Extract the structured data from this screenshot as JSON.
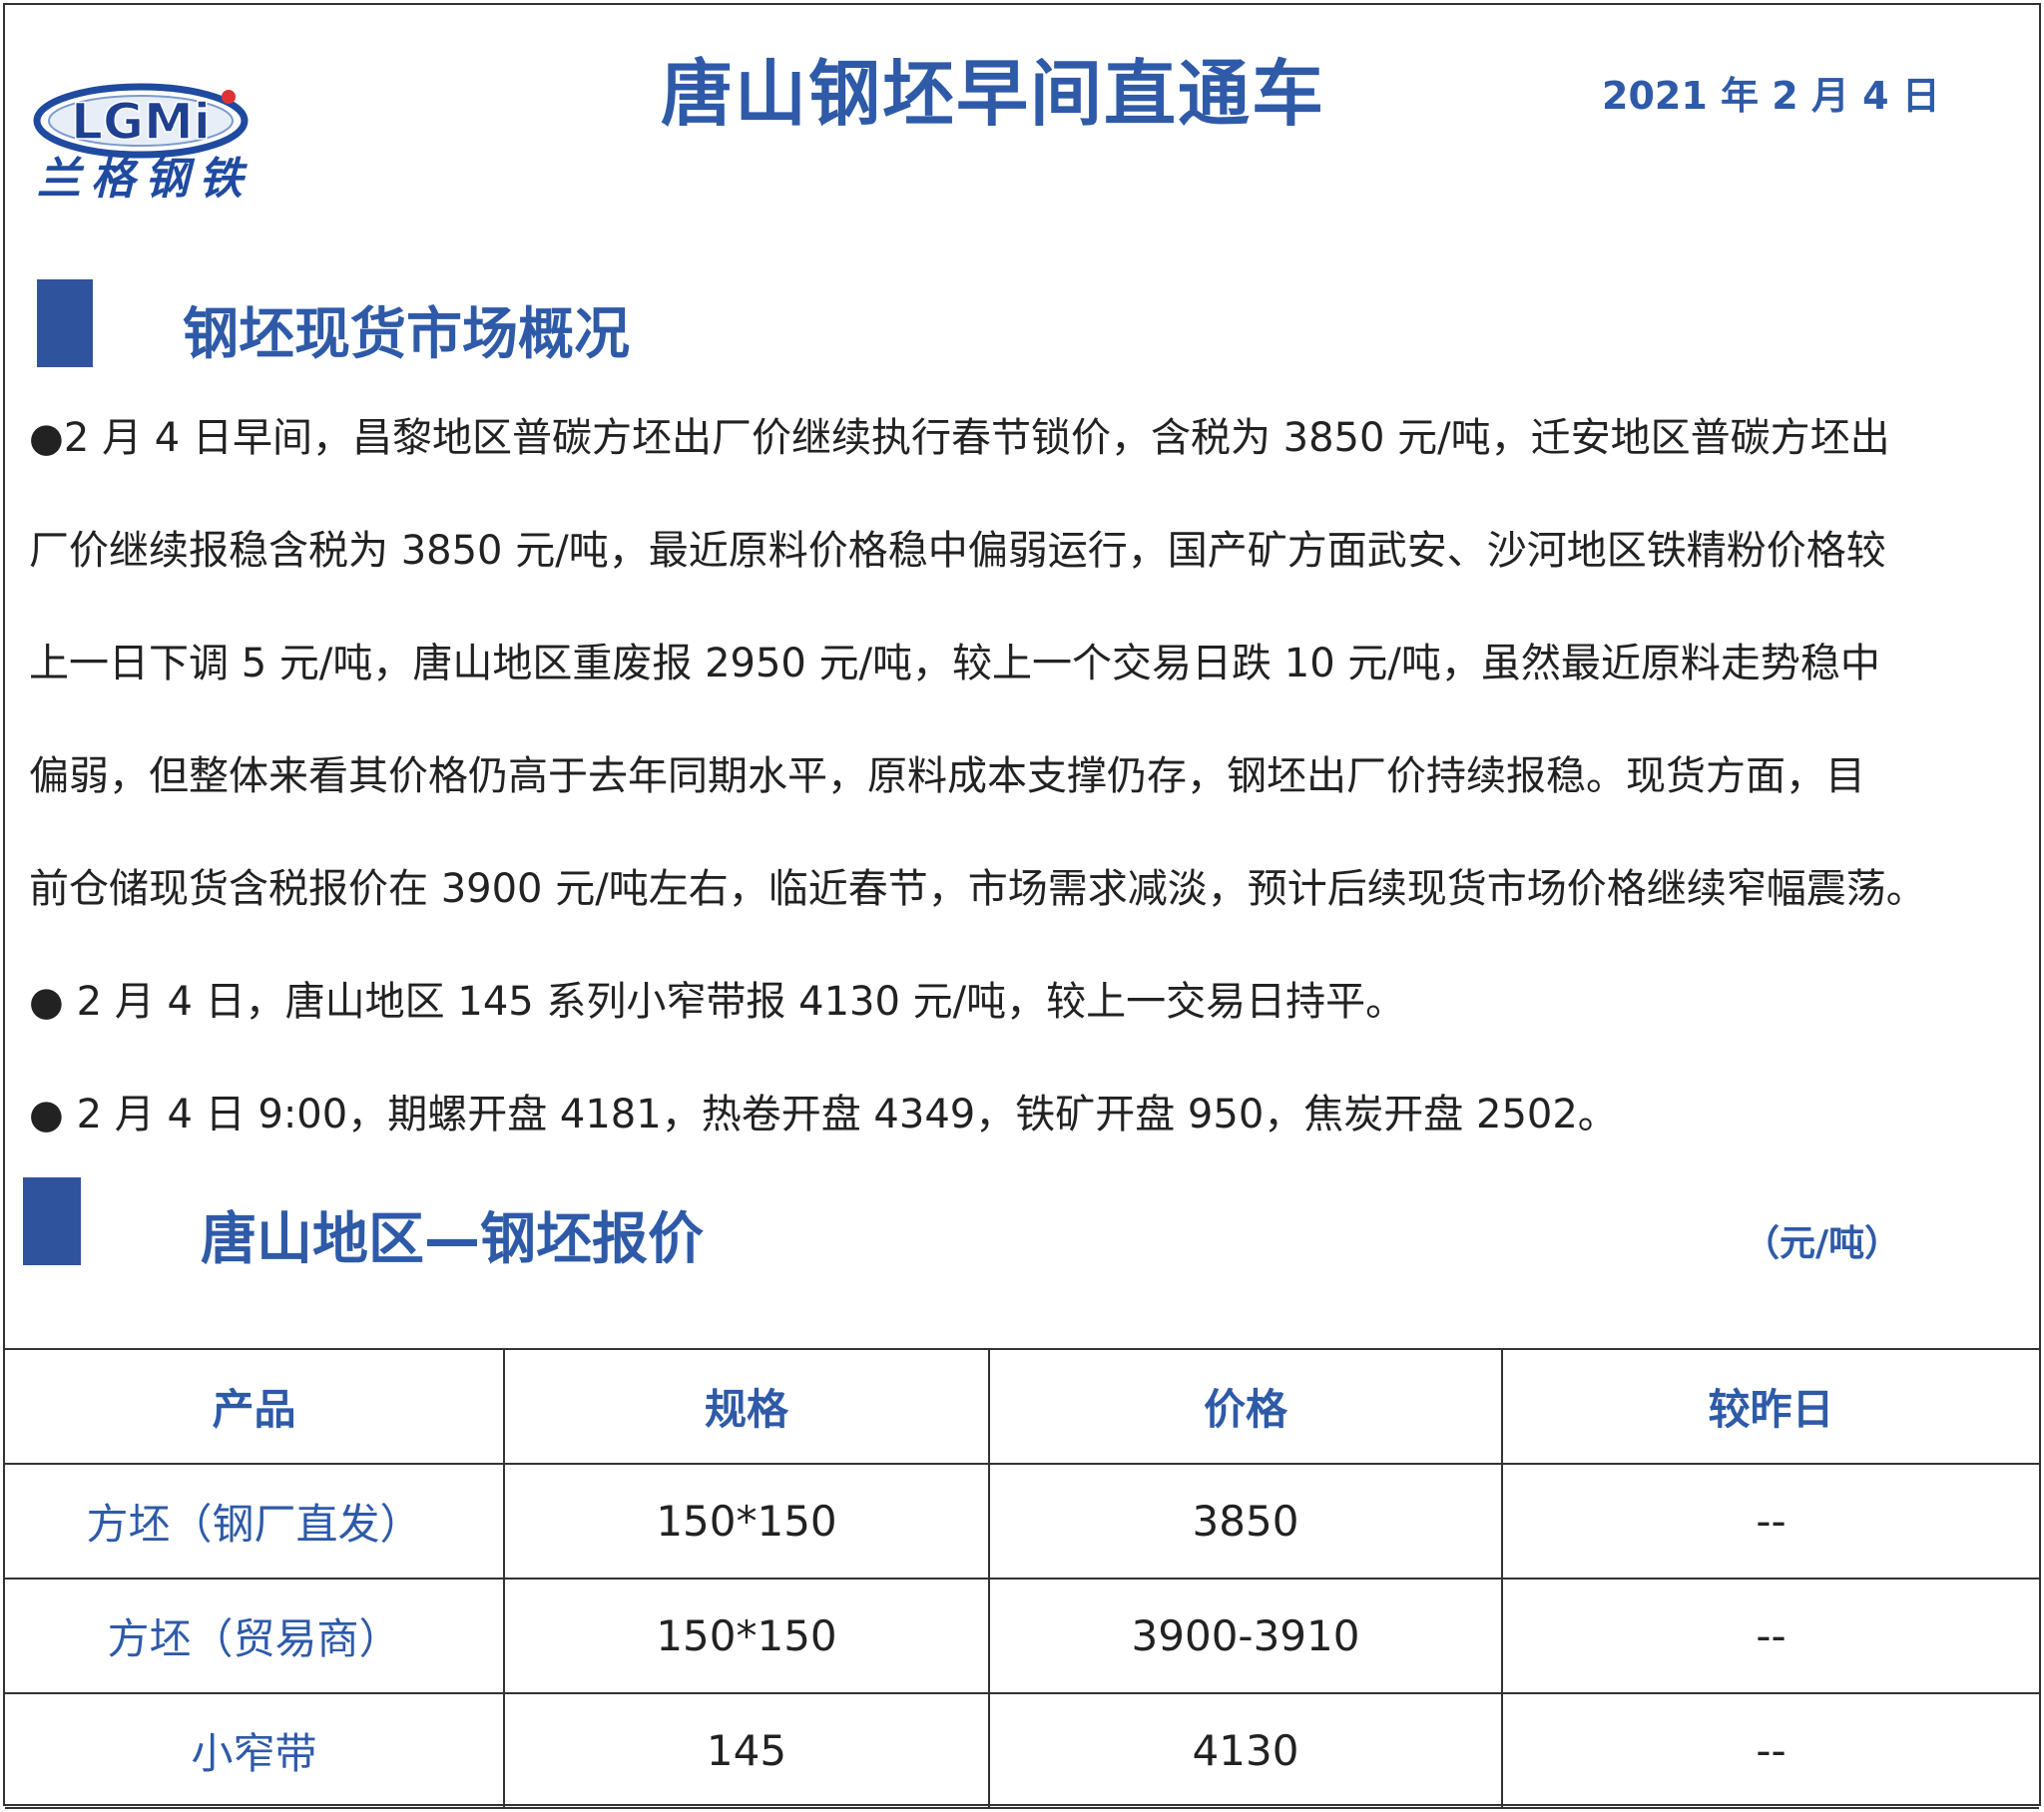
{
  "header": {
    "logo_text": "LGMi",
    "logo_cn": "兰格钢铁",
    "title": "唐山钢坯早间直通车",
    "date": "2021 年 2 月 4 日"
  },
  "section1": {
    "title": "钢坯现货市场概况",
    "paragraph_lines": [
      "●2 月 4 日早间，昌黎地区普碳方坯出厂价继续执行春节锁价，含税为 3850 元/吨，迁安地区普碳方坯出",
      "厂价继续报稳含税为 3850 元/吨，最近原料价格稳中偏弱运行，国产矿方面武安、沙河地区铁精粉价格较",
      "上一日下调 5 元/吨，唐山地区重废报 2950 元/吨，较上一个交易日跌 10 元/吨，虽然最近原料走势稳中",
      "偏弱，但整体来看其价格仍高于去年同期水平，原料成本支撑仍存，钢坯出厂价持续报稳。现货方面，目",
      "前仓储现货含税报价在 3900 元/吨左右，临近春节，市场需求减淡，预计后续现货市场价格继续窄幅震荡。"
    ],
    "bullet2": "●  2 月 4 日，唐山地区 145 系列小窄带报 4130 元/吨，较上一交易日持平。",
    "bullet3": "●  2 月 4 日 9:00，期螺开盘 4181，热卷开盘 4349，铁矿开盘 950，焦炭开盘 2502。"
  },
  "section2": {
    "title": "唐山地区—钢坯报价",
    "unit": "（元/吨）"
  },
  "table": {
    "headers": [
      "产品",
      "规格",
      "价格",
      "较昨日"
    ],
    "rows": [
      [
        "方坯（钢厂直发）",
        "150*150",
        "3850",
        "--"
      ],
      [
        "方坯（贸易商）",
        "150*150",
        "3900-3910",
        "--"
      ],
      [
        "小窄带",
        "145",
        "4130",
        "--"
      ]
    ]
  }
}
